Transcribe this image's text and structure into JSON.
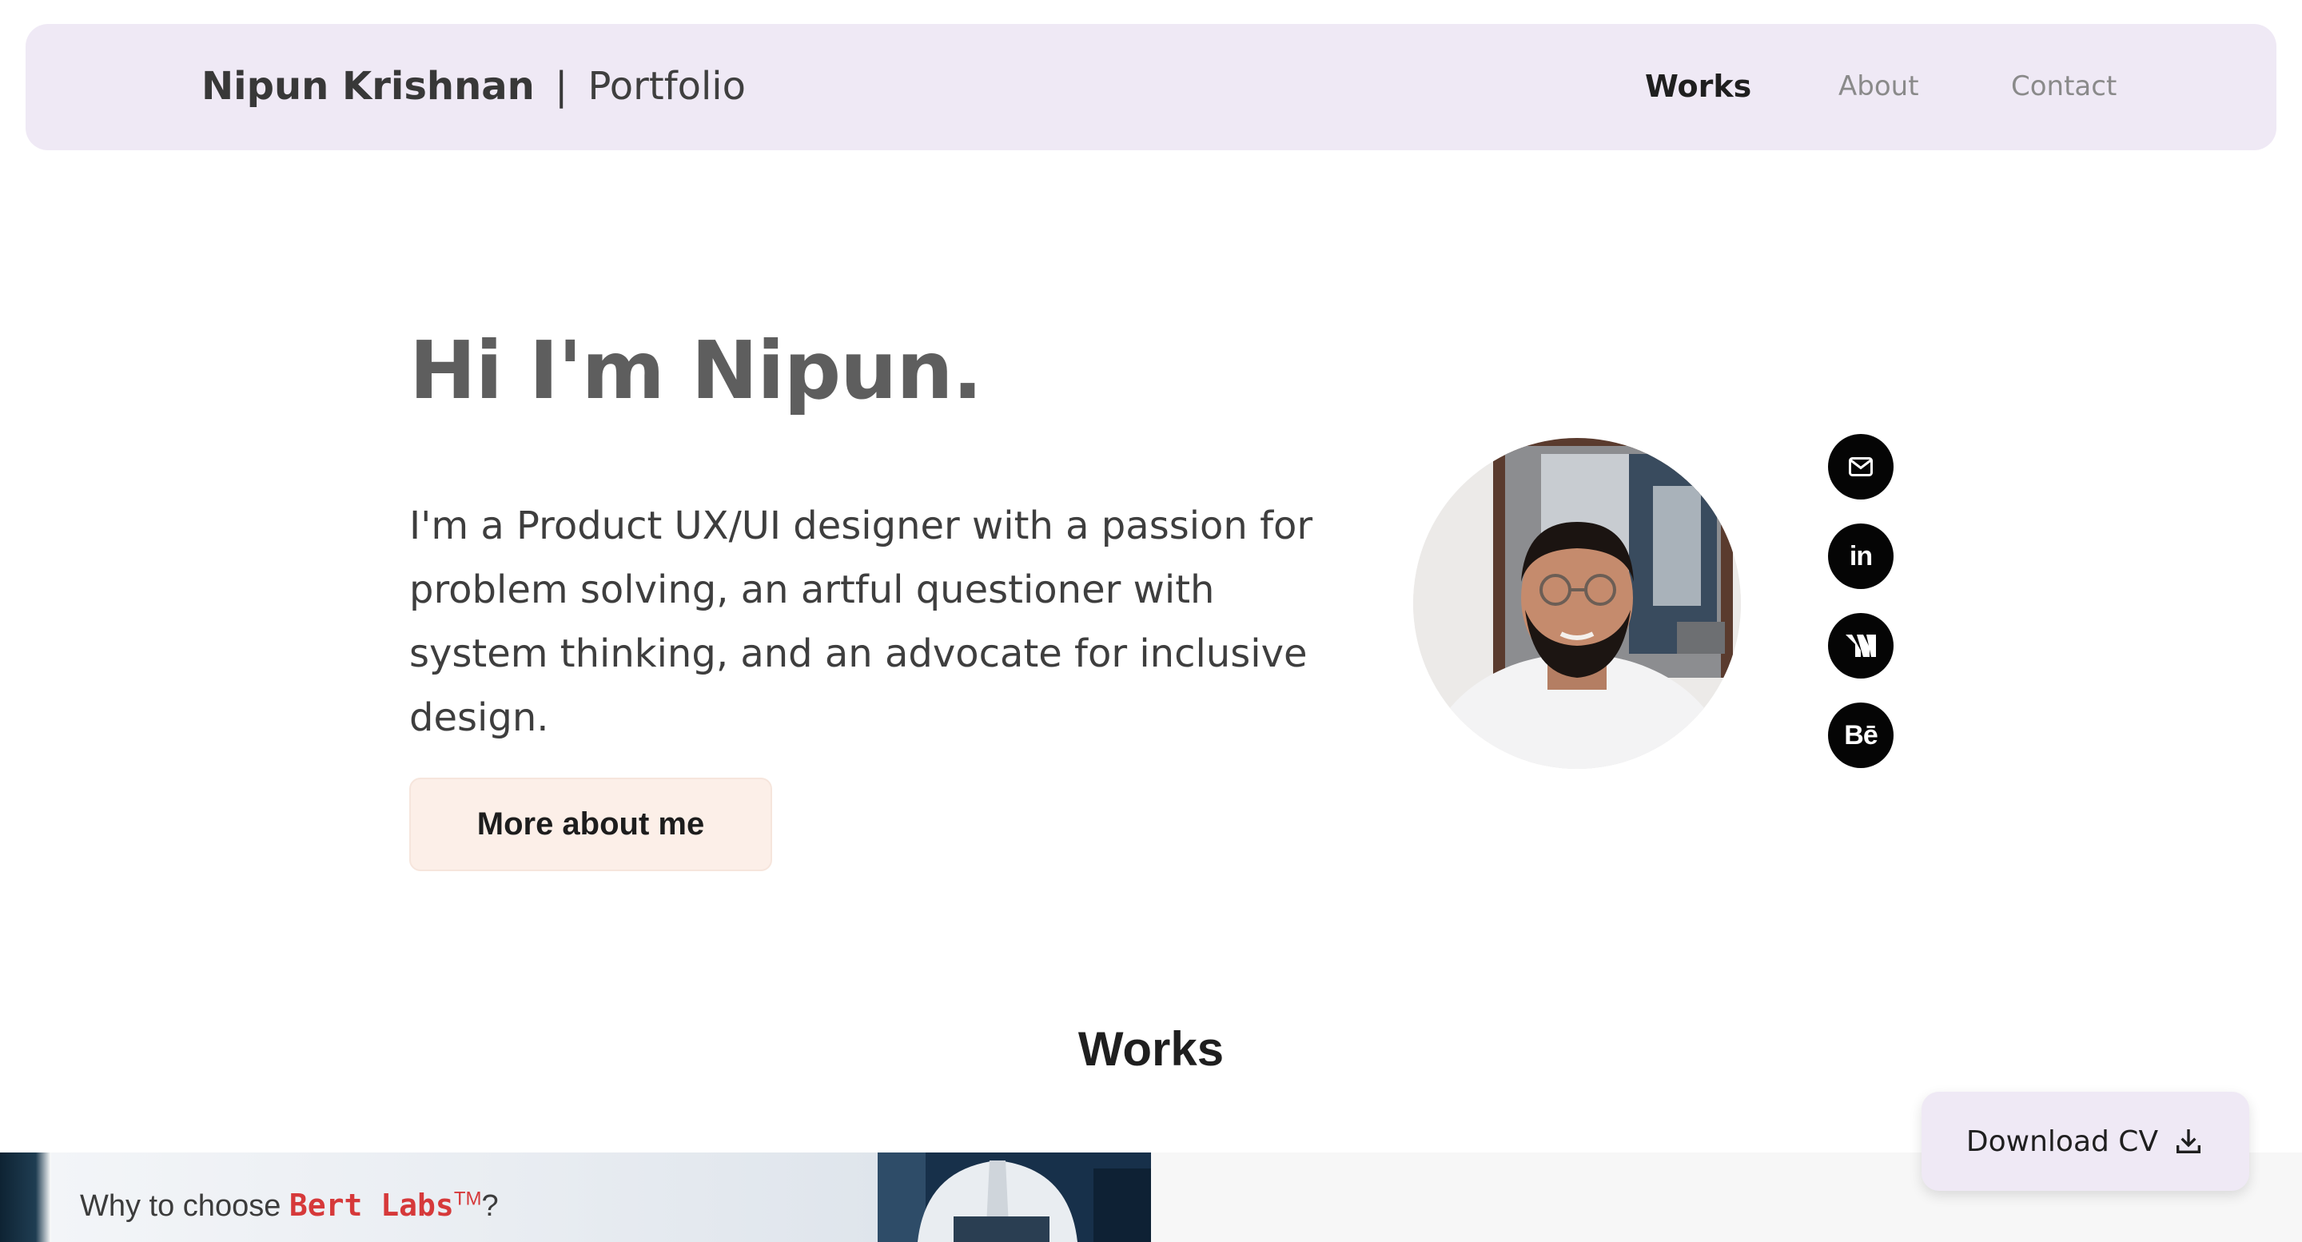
{
  "nav": {
    "brand_name": "Nipun Krishnan",
    "brand_separator": "|",
    "brand_sub": "Portfolio",
    "links": [
      {
        "label": "Works",
        "active": true
      },
      {
        "label": "About",
        "active": false
      },
      {
        "label": "Contact",
        "active": false
      }
    ]
  },
  "hero": {
    "title": "Hi I'm Nipun.",
    "description": "I'm a Product UX/UI designer with a passion for problem solving, an artful questioner with system thinking, and an advocate for inclusive design.",
    "cta_label": "More about me"
  },
  "social": [
    {
      "icon": "mail-icon",
      "label": ""
    },
    {
      "icon": "linkedin-icon",
      "label": "in"
    },
    {
      "icon": "medium-icon",
      "label": ""
    },
    {
      "icon": "behance-icon",
      "label": "Bē"
    }
  ],
  "works": {
    "heading": "Works",
    "card": {
      "prefix": "Why to choose ",
      "brand": "Bert Labs",
      "tm": "TM",
      "suffix": "?"
    }
  },
  "download": {
    "label": "Download CV",
    "icon": "download-icon"
  },
  "colors": {
    "nav_bg": "#efe9f5",
    "cta_bg": "#fcefe8",
    "brand_red": "#d6393a",
    "social_bg": "#050505"
  }
}
